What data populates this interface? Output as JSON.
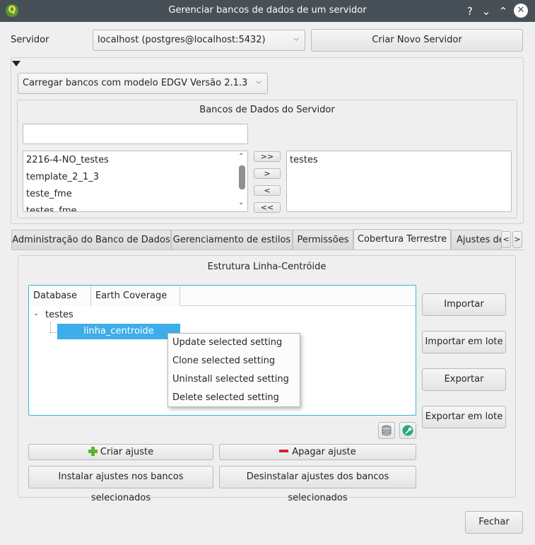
{
  "window": {
    "title": "Gerenciar bancos de dados de um servidor",
    "help": "?",
    "min": "⌄",
    "max": "⌃",
    "close": "✕"
  },
  "server": {
    "label": "Servidor",
    "selected": "localhost (postgres@localhost:5432)",
    "new_button": "Criar Novo Servidor"
  },
  "template_combo": {
    "selected": "Carregar bancos com modelo EDGV Versão 2.1.3"
  },
  "db_group": {
    "title": "Bancos de Dados do Servidor",
    "filter_value": "",
    "available": [
      "2216-4-NO_testes",
      "template_2_1_3",
      "teste_fme",
      "testes_fme"
    ],
    "selected": [
      "testes"
    ],
    "move_buttons": {
      "all_right": ">>",
      "right": ">",
      "left": "<",
      "all_left": "<<"
    }
  },
  "tabs": [
    {
      "label": "Administração do Banco de Dados",
      "active": false
    },
    {
      "label": "Gerenciamento de estilos",
      "active": false
    },
    {
      "label": "Permissões",
      "active": false
    },
    {
      "label": "Cobertura Terrestre",
      "active": true
    },
    {
      "label": "Ajustes de",
      "active": false
    }
  ],
  "tab_scroll": {
    "left": "<",
    "right": ">"
  },
  "coverage": {
    "title": "Estrutura Linha-Centróide",
    "columns": [
      "Database",
      "Earth Coverage"
    ],
    "tree": {
      "root": "testes",
      "child": "linha_centroide"
    },
    "side_buttons": [
      "Importar",
      "Importar em lote",
      "Exportar",
      "Exportar em lote"
    ],
    "create_button": "Criar ajuste",
    "delete_button": "Apagar ajuste",
    "install_button": "Instalar ajustes nos bancos selecionados",
    "uninstall_button": "Desinstalar ajustes dos bancos selecionados"
  },
  "context_menu": [
    "Update selected setting",
    "Clone selected setting",
    "Uninstall selected setting",
    "Delete selected setting"
  ],
  "footer": {
    "close_button": "Fechar"
  },
  "colors": {
    "titlebar": "#475057",
    "selection": "#3daee9",
    "plus": "#5ab52f",
    "minus": "#d8222a"
  }
}
